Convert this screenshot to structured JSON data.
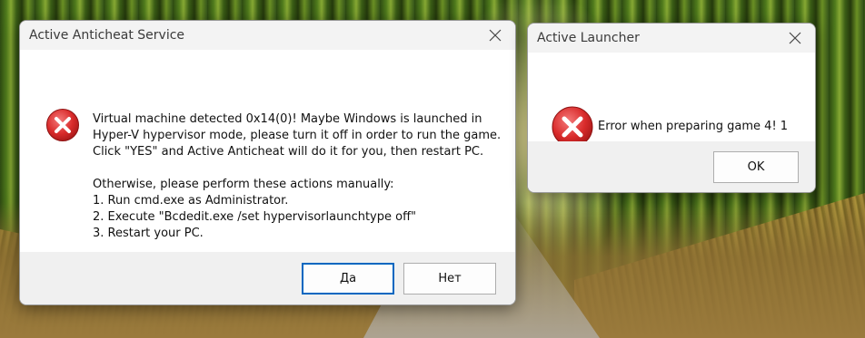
{
  "colors": {
    "error_red": "#d92b2b",
    "accent_blue": "#0067c0",
    "footer_gray": "#f0f0f0"
  },
  "anticheat_dialog": {
    "title": "Active Anticheat Service",
    "icon": "error-icon",
    "message": "Virtual machine detected 0x14(0)! Maybe Windows is launched in\nHyper-V hypervisor mode, please turn it off in order to run the game.\nClick \"YES\" and Active Anticheat will do it for you, then restart PC.\n\nOtherwise, please perform these actions manually:\n1. Run cmd.exe as Administrator.\n2. Execute \"Bcdedit.exe /set hypervisorlaunchtype off\"\n3. Restart your PC.",
    "buttons": {
      "yes_label": "Да",
      "no_label": "Нет"
    }
  },
  "launcher_dialog": {
    "title": "Active Launcher",
    "icon": "error-icon",
    "message": "Error when preparing game 4! 1",
    "buttons": {
      "ok_label": "OK"
    }
  }
}
